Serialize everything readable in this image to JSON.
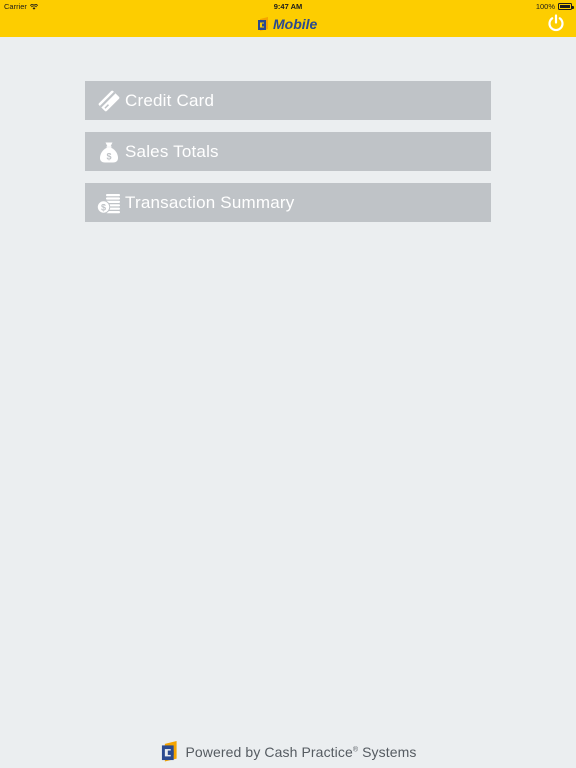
{
  "status_bar": {
    "carrier": "Carrier",
    "time": "9:47 AM",
    "battery": "100%"
  },
  "header": {
    "title": "Mobile",
    "logo_icon": "cash-practice-logo-icon",
    "power_icon": "power-icon"
  },
  "menu": {
    "items": [
      {
        "label": "Credit Card",
        "icon": "credit-card-icon"
      },
      {
        "label": "Sales Totals",
        "icon": "money-bag-icon"
      },
      {
        "label": "Transaction Summary",
        "icon": "coins-stack-icon"
      }
    ]
  },
  "footer": {
    "prefix": "Powered by Cash Practice",
    "registered": "®",
    "suffix": " Systems"
  },
  "colors": {
    "header_bg": "#fdcd00",
    "page_bg": "#ebeef0",
    "menu_item_bg": "#bfc3c7",
    "brand_blue": "#2b4a8f",
    "logo_orange": "#f5a400"
  }
}
